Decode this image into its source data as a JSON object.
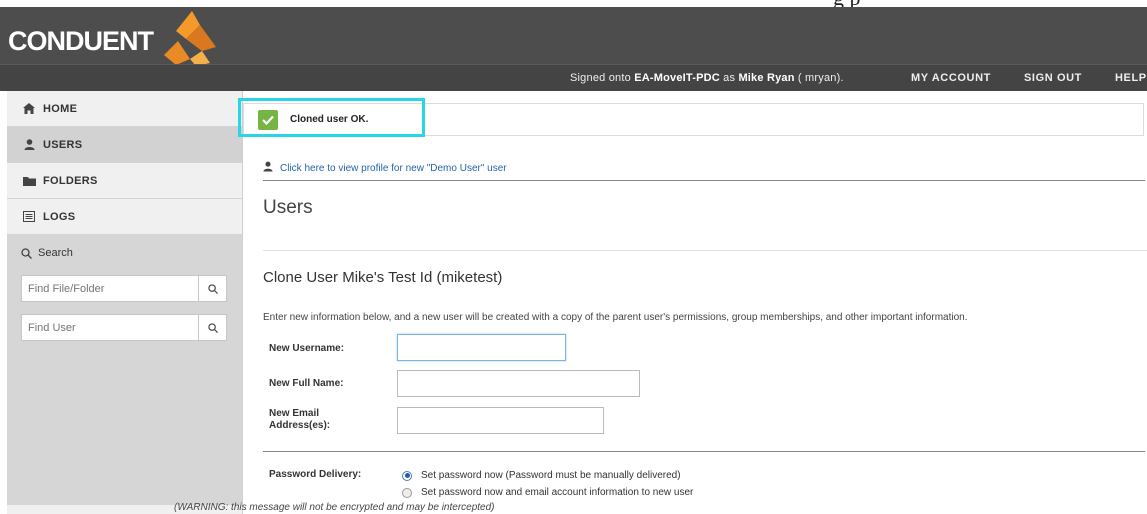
{
  "top_strip_text": "g        p",
  "brand": {
    "logo_text": "CONDUENT",
    "colors": {
      "logo_orange": "#f39a2b",
      "logo_dark_orange": "#d9781f"
    }
  },
  "header": {
    "signed_prefix": "Signed onto ",
    "site": "EA-MoveIT-PDC",
    "as_text": " as ",
    "user_name": "Mike Ryan",
    "user_id": " ( mryan).",
    "links": {
      "my_account": "MY ACCOUNT",
      "sign_out": "SIGN OUT",
      "help": "HELP"
    }
  },
  "sidebar": {
    "items": [
      {
        "label": "HOME",
        "icon": "home-icon"
      },
      {
        "label": "USERS",
        "icon": "user-icon"
      },
      {
        "label": "FOLDERS",
        "icon": "folder-icon"
      },
      {
        "label": "LOGS",
        "icon": "log-icon"
      }
    ],
    "search_title": "Search",
    "find_file_placeholder": "Find File/Folder",
    "find_user_placeholder": "Find User"
  },
  "notice": {
    "text": "Cloned user OK.",
    "icon": "check-icon",
    "highlight_color": "#29d6e6"
  },
  "main": {
    "profile_link": "Click here to view profile for new \"Demo User\" user",
    "page_title": "Users",
    "clone_title": "Clone User Mike's Test Id (miketest)",
    "instructions": "Enter new information below, and a new user will be created with a copy of the parent user's permissions, group memberships, and other important information."
  },
  "form": {
    "new_username_label": "New Username:",
    "new_username_value": "",
    "new_full_name_label": "New Full Name:",
    "new_full_name_value": "",
    "new_email_label_line1": "New Email",
    "new_email_label_line2": "Address(es):",
    "new_email_value": "",
    "password_delivery_label": "Password Delivery:",
    "password_options": [
      "Set password now (Password must be manually delivered)",
      "Set password now and email account information to new user"
    ],
    "password_selected_index": 0,
    "warning": "(WARNING: this message will not be encrypted and may be intercepted)"
  }
}
